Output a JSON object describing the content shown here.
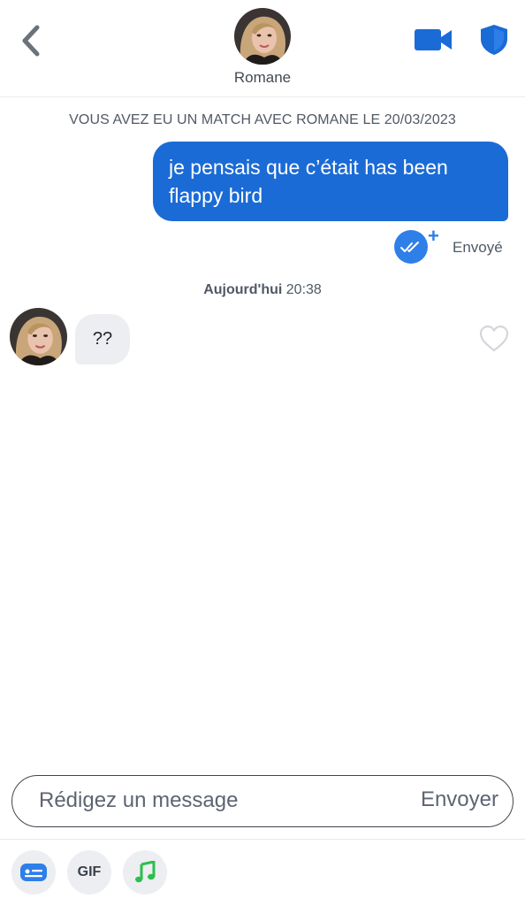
{
  "header": {
    "contact_name": "Romane",
    "back_icon": "chevron-left-icon",
    "video_icon": "video-camera-icon",
    "safety_icon": "shield-icon",
    "accent_color": "#1a6bd6"
  },
  "conversation": {
    "match_banner": "VOUS AVEZ EU UN MATCH AVEC ROMANE LE 20/03/2023",
    "sent_message": {
      "text": "je pensais que c’était has been flappy bird",
      "status": "Envoyé",
      "status_icon": "double-check-icon",
      "plus": "+"
    },
    "timestamp_day": "Aujourd'hui",
    "timestamp_time": "20:38",
    "received_message": {
      "text": "??",
      "like_icon": "heart-outline-icon"
    }
  },
  "composer": {
    "placeholder": "Rédigez un message",
    "send_label": "Envoyer"
  },
  "toolbar": {
    "sticker_icon": "sticker-card-icon",
    "gif_label": "GIF",
    "music_icon": "music-note-icon"
  }
}
